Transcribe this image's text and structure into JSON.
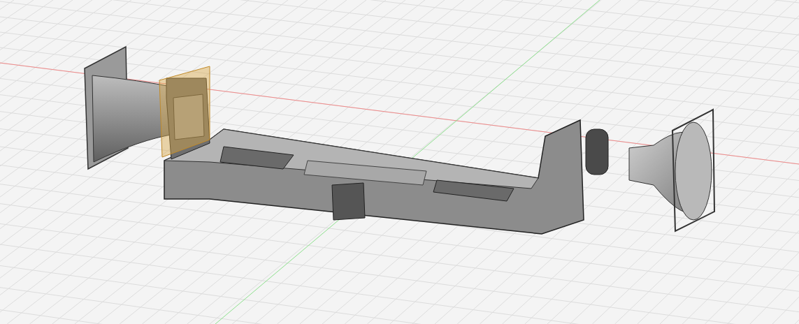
{
  "viewport": {
    "grid": true,
    "section_plane": true
  }
}
